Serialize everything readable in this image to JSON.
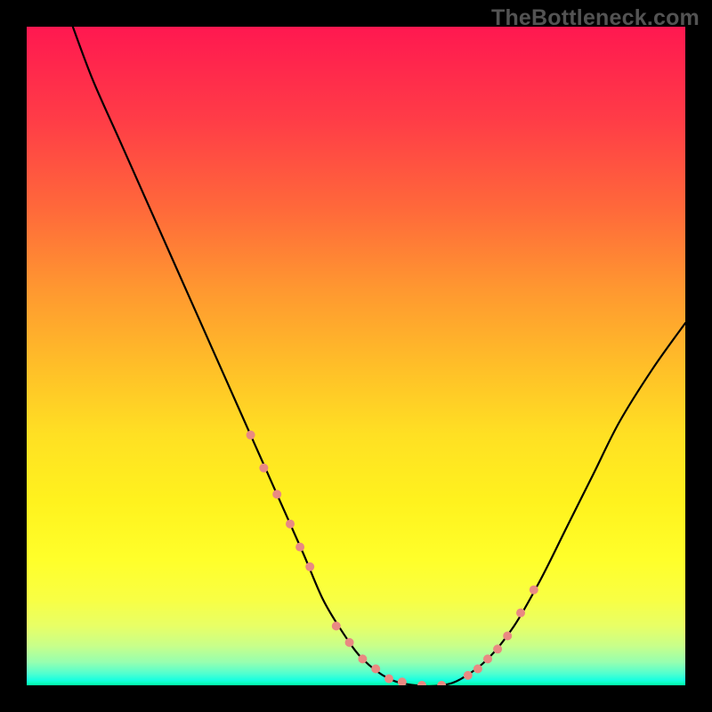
{
  "watermark": "TheBottleneck.com",
  "chart_data": {
    "type": "line",
    "title": "",
    "xlabel": "",
    "ylabel": "",
    "xlim": [
      0,
      100
    ],
    "ylim": [
      0,
      100
    ],
    "grid": false,
    "legend": false,
    "background_gradient": {
      "stops": [
        {
          "pos": 0.0,
          "color": "#ff1850"
        },
        {
          "pos": 0.14,
          "color": "#ff3c47"
        },
        {
          "pos": 0.28,
          "color": "#ff6a3a"
        },
        {
          "pos": 0.4,
          "color": "#ff9830"
        },
        {
          "pos": 0.52,
          "color": "#ffc028"
        },
        {
          "pos": 0.62,
          "color": "#ffe023"
        },
        {
          "pos": 0.72,
          "color": "#fff21e"
        },
        {
          "pos": 0.81,
          "color": "#ffff2a"
        },
        {
          "pos": 0.87,
          "color": "#f8ff44"
        },
        {
          "pos": 0.91,
          "color": "#e8ff66"
        },
        {
          "pos": 0.94,
          "color": "#c8ff8a"
        },
        {
          "pos": 0.965,
          "color": "#96ffb0"
        },
        {
          "pos": 0.982,
          "color": "#52ffcf"
        },
        {
          "pos": 0.992,
          "color": "#19ffe0"
        },
        {
          "pos": 1.0,
          "color": "#00ffa8"
        }
      ]
    },
    "series": [
      {
        "name": "curve",
        "x": [
          7,
          10,
          14,
          18,
          22,
          26,
          30,
          34,
          38,
          42,
          45,
          48,
          51,
          55,
          59,
          63,
          66,
          70,
          74,
          78,
          82,
          86,
          90,
          95,
          100
        ],
        "y": [
          100,
          92,
          83,
          74,
          65,
          56,
          47,
          38,
          29,
          20,
          13,
          8,
          4,
          1,
          0,
          0,
          1,
          4,
          9,
          16,
          24,
          32,
          40,
          48,
          55
        ]
      }
    ],
    "markers": {
      "name": "highlight-points",
      "color": "#e98a82",
      "radius": 5,
      "x": [
        34,
        36,
        38,
        40,
        41.5,
        43,
        47,
        49,
        51,
        53,
        55,
        57,
        60,
        63,
        67,
        68.5,
        70,
        71.5,
        73,
        75,
        77
      ],
      "y": [
        38,
        33,
        29,
        24.5,
        21,
        18,
        9,
        6.5,
        4,
        2.5,
        1,
        0.5,
        0,
        0,
        1.5,
        2.5,
        4,
        5.5,
        7.5,
        11,
        14.5
      ]
    }
  }
}
